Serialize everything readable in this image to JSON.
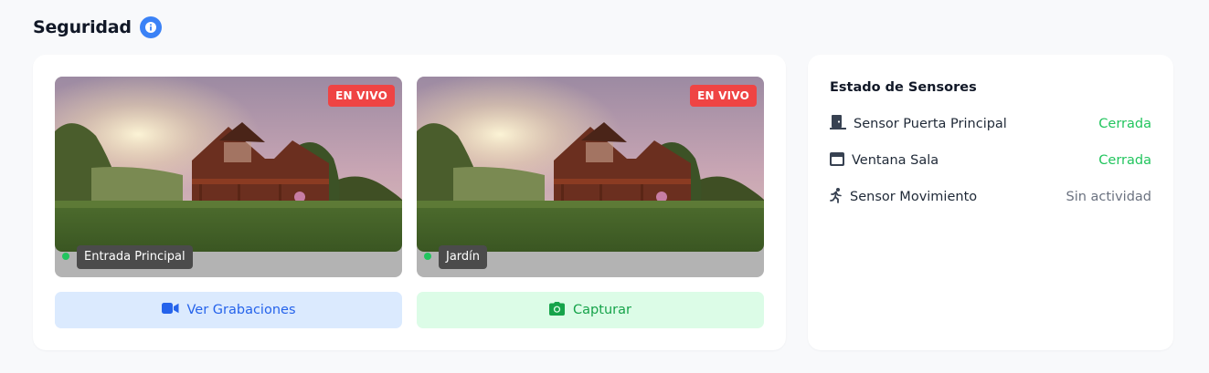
{
  "header": {
    "title": "Seguridad",
    "info_icon": "info-icon",
    "accent": "#3b82f6"
  },
  "cameras": [
    {
      "name": "Entrada Principal",
      "badge": "EN VIVO",
      "status": "online"
    },
    {
      "name": "Jardín",
      "badge": "EN VIVO",
      "status": "online"
    }
  ],
  "actions": {
    "recordings_label": "Ver Grabaciones",
    "recordings_icon": "video-camera-icon",
    "capture_label": "Capturar",
    "capture_icon": "camera-icon"
  },
  "sensors": {
    "title": "Estado de Sensores",
    "items": [
      {
        "name": "Sensor Puerta Principal",
        "status": "Cerrada",
        "icon": "door-icon",
        "status_color": "#22c55e"
      },
      {
        "name": "Ventana Sala",
        "status": "Cerrada",
        "icon": "window-icon",
        "status_color": "#22c55e"
      },
      {
        "name": "Sensor Movimiento",
        "status": "Sin actividad",
        "icon": "running-person-icon",
        "status_color": "#6b7280"
      }
    ]
  },
  "colors": {
    "live_badge": "#ef4444",
    "online_dot": "#22c55e",
    "recordings_bg": "#dbeafe",
    "capture_bg": "#dcfce7"
  }
}
